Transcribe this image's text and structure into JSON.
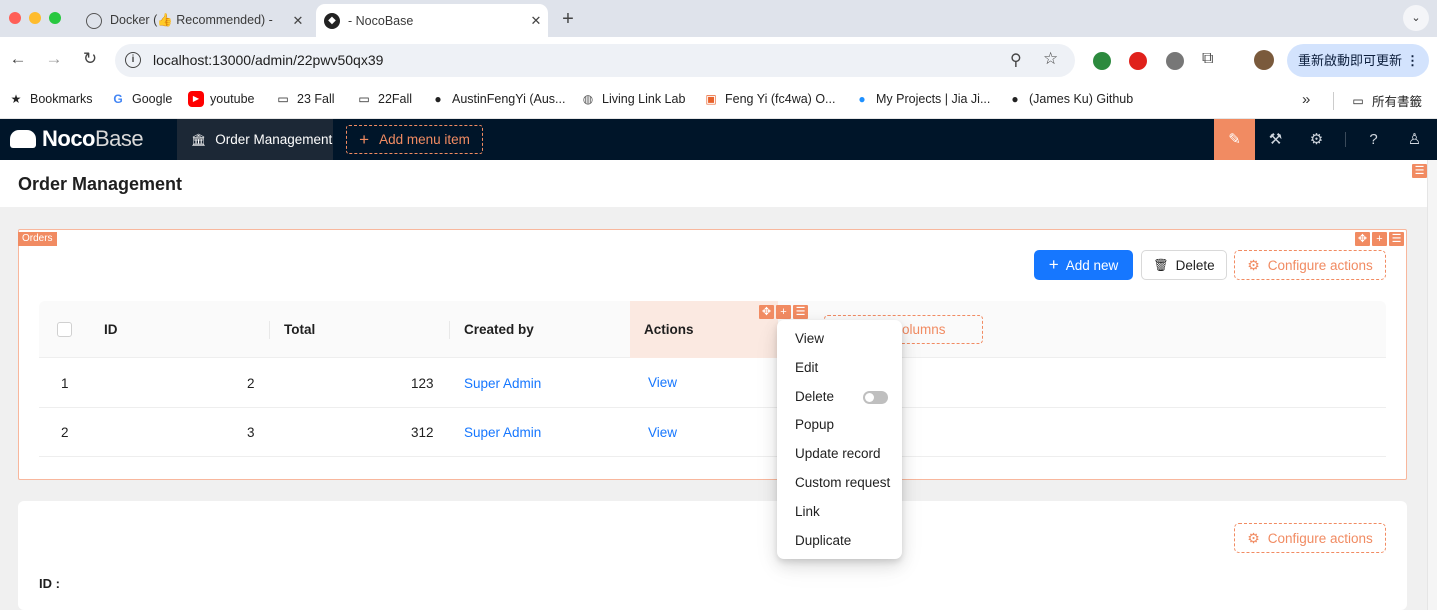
{
  "browser": {
    "tabs": [
      {
        "title": "Docker (👍 Recommended) -",
        "favicon": "nocobase-outline-icon",
        "active": false
      },
      {
        "title": "- NocoBase",
        "favicon": "nocobase-icon",
        "active": true
      }
    ],
    "new_tab_symbol": "+",
    "close_symbol": "✕",
    "url": "localhost:13000/admin/22pwv50qx39",
    "update_button": "重新啟動即可更新",
    "bookmarks": [
      {
        "label": "Bookmarks",
        "icon": "star-icon"
      },
      {
        "label": "Google",
        "icon": "google-icon"
      },
      {
        "label": "youtube",
        "icon": "youtube-icon"
      },
      {
        "label": "23 Fall",
        "icon": "folder-icon"
      },
      {
        "label": "22Fall",
        "icon": "folder-icon"
      },
      {
        "label": "AustinFengYi (Aus...",
        "icon": "github-icon"
      },
      {
        "label": "Living Link Lab",
        "icon": "globe-icon"
      },
      {
        "label": "Feng Yi (fc4wa) O...",
        "icon": "university-icon"
      },
      {
        "label": "My Projects | Jia Ji...",
        "icon": "blue-dot-icon"
      },
      {
        "label": "(James Ku) Github",
        "icon": "github-icon"
      }
    ],
    "all_bookmarks": "所有書籤"
  },
  "app": {
    "logo": {
      "part1": "Noco",
      "part2": "Base"
    },
    "menu_active": "Order Management",
    "add_menu_item": "Add menu item",
    "accent_color": "#f18b62",
    "header_color": "#001529"
  },
  "page": {
    "title": "Order Management",
    "block_tag": "Orders",
    "actions": {
      "add_new": "Add new",
      "delete": "Delete",
      "configure_actions": "Configure actions"
    },
    "table": {
      "columns": [
        "ID",
        "Total",
        "Created by",
        "Actions"
      ],
      "configure_columns": "Configure columns",
      "rows": [
        {
          "index": "1",
          "id": "2",
          "total": "123",
          "created_by": "Super Admin",
          "action": "View"
        },
        {
          "index": "2",
          "id": "3",
          "total": "312",
          "created_by": "Super Admin",
          "action": "View"
        }
      ]
    },
    "details": {
      "configure_actions": "Configure actions",
      "id_label": "ID :"
    }
  },
  "dropdown": {
    "items": [
      "View",
      "Edit",
      "Delete",
      "Popup",
      "Update record",
      "Custom request",
      "Link",
      "Duplicate"
    ],
    "delete_toggle_on": false
  }
}
